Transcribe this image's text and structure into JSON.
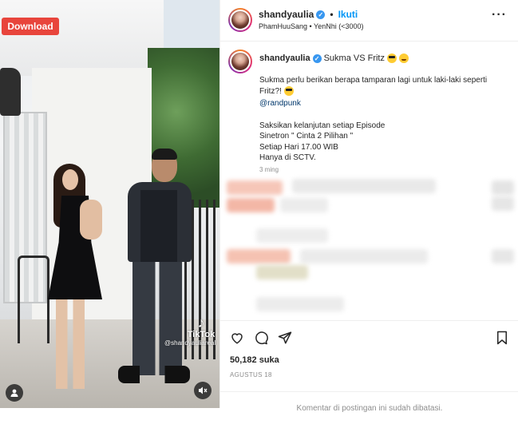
{
  "media": {
    "download_label": "Download",
    "tiktok_brand": "TikTok",
    "tiktok_handle": "@shandyauliareal"
  },
  "header": {
    "username": "shandyaulia",
    "separator": "•",
    "follow_label": "Ikuti",
    "subtitle": "PhamHuuSang • YenNhi (<3000)"
  },
  "caption": {
    "username": "shandyaulia",
    "title": "Sukma VS Fritz",
    "line1": "Sukma perlu berikan berapa tamparan lagi untuk laki-laki seperti",
    "line2": "Fritz?!",
    "mention": "@randpunk",
    "line3": "Saksikan kelanjutan setiap Episode",
    "line4": "Sinetron \" Cinta 2 Pilihan \"",
    "line5": "Setiap Hari 17.00 WIB",
    "line6": "Hanya di SCTV.",
    "time_ago": "3 ming"
  },
  "actions": {
    "likes": "50,182 suka",
    "date": "AGUSTUS 18",
    "comments_disabled": "Komentar di postingan ini sudah dibatasi."
  },
  "icons": [
    "heart-icon",
    "comment-icon",
    "share-icon",
    "bookmark-icon",
    "more-icon",
    "verified-icon",
    "user-tag-icon",
    "mute-icon"
  ],
  "colors": {
    "link_blue": "#0095f6",
    "verified_blue": "#3897f0",
    "download_red": "#e8453c",
    "muted_text": "#8e8e8e"
  }
}
